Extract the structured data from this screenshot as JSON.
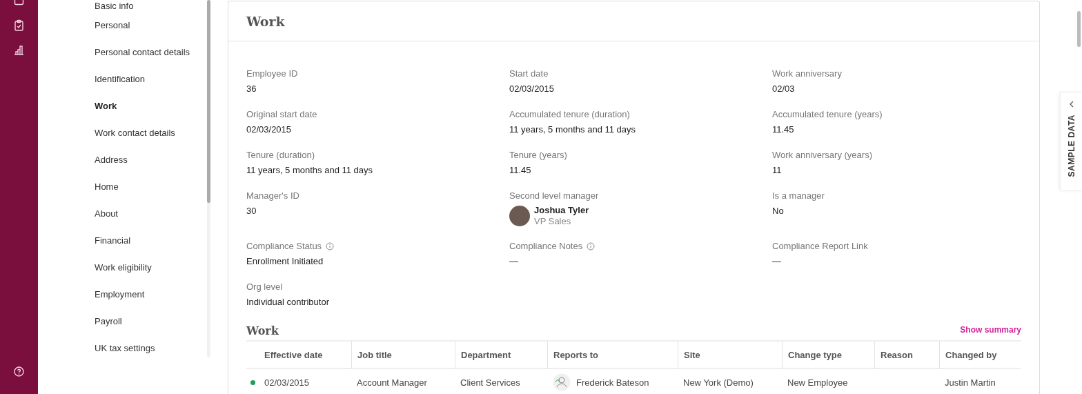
{
  "sidebar": {
    "items": [
      {
        "label": "Basic info",
        "selected": false
      },
      {
        "label": "Personal",
        "selected": false
      },
      {
        "label": "Personal contact details",
        "selected": false
      },
      {
        "label": "Identification",
        "selected": false
      },
      {
        "label": "Work",
        "selected": true
      },
      {
        "label": "Work contact details",
        "selected": false
      },
      {
        "label": "Address",
        "selected": false
      },
      {
        "label": "Home",
        "selected": false
      },
      {
        "label": "About",
        "selected": false
      },
      {
        "label": "Financial",
        "selected": false
      },
      {
        "label": "Work eligibility",
        "selected": false
      },
      {
        "label": "Employment",
        "selected": false
      },
      {
        "label": "Payroll",
        "selected": false
      },
      {
        "label": "UK tax settings",
        "selected": false
      }
    ]
  },
  "card": {
    "title": "Work",
    "fields": [
      {
        "kind": "text",
        "label": "Employee ID",
        "value": "36"
      },
      {
        "kind": "text",
        "label": "Start date",
        "value": "02/03/2015"
      },
      {
        "kind": "text",
        "label": "Work anniversary",
        "value": "02/03"
      },
      {
        "kind": "text",
        "label": "Original start date",
        "value": "02/03/2015"
      },
      {
        "kind": "text",
        "label": "Accumulated tenure (duration)",
        "value": "11 years, 5 months and 11 days"
      },
      {
        "kind": "text",
        "label": "Accumulated tenure (years)",
        "value": "11.45"
      },
      {
        "kind": "text",
        "label": "Tenure (duration)",
        "value": "11 years, 5 months and 11 days"
      },
      {
        "kind": "text",
        "label": "Tenure (years)",
        "value": "11.45"
      },
      {
        "kind": "text",
        "label": "Work anniversary (years)",
        "value": "11"
      },
      {
        "kind": "text",
        "label": "Manager's ID",
        "value": "30"
      },
      {
        "kind": "person",
        "label": "Second level manager",
        "name": "Joshua Tyler",
        "subtitle": "VP Sales"
      },
      {
        "kind": "text",
        "label": "Is a manager",
        "value": "No"
      },
      {
        "kind": "text",
        "label": "Compliance Status",
        "info": true,
        "value": "Enrollment Initiated"
      },
      {
        "kind": "text",
        "label": "Compliance Notes",
        "info": true,
        "value": "—"
      },
      {
        "kind": "text",
        "label": "Compliance Report Link",
        "value": "—"
      },
      {
        "kind": "text",
        "label": "Org level",
        "value": "Individual contributor"
      }
    ]
  },
  "table": {
    "title": "Work",
    "action": "Show summary",
    "columns": [
      "Effective date",
      "Job title",
      "Department",
      "Reports to",
      "Site",
      "Change type",
      "Reason",
      "Changed by"
    ],
    "rows": [
      {
        "color": "#1e9e5a",
        "cells": [
          "02/03/2015",
          "Account Manager",
          "Client Services",
          "Frederick Bateson",
          "New York (Demo)",
          "New Employee",
          "",
          "Justin Martin"
        ]
      }
    ]
  },
  "sample_tab": {
    "label": "SAMPLE DATA"
  }
}
